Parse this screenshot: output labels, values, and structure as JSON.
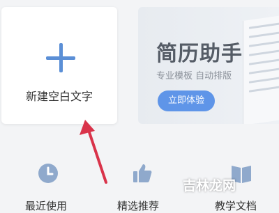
{
  "new_blank": {
    "label": "新建空白文字"
  },
  "banner": {
    "title": "简历助手",
    "subtitle": "专业模板 自动排版",
    "button_label": "立即体验"
  },
  "nav": [
    {
      "label": "最近使用",
      "icon": "clock-icon"
    },
    {
      "label": "精选推荐",
      "icon": "thumbs-up-icon"
    },
    {
      "label": "教学文档",
      "icon": "book-icon"
    }
  ],
  "watermark": "吉林龙网",
  "colors": {
    "accent": "#5f95e8",
    "arrow": "#d9334a",
    "icon": "#8fa9cc"
  }
}
